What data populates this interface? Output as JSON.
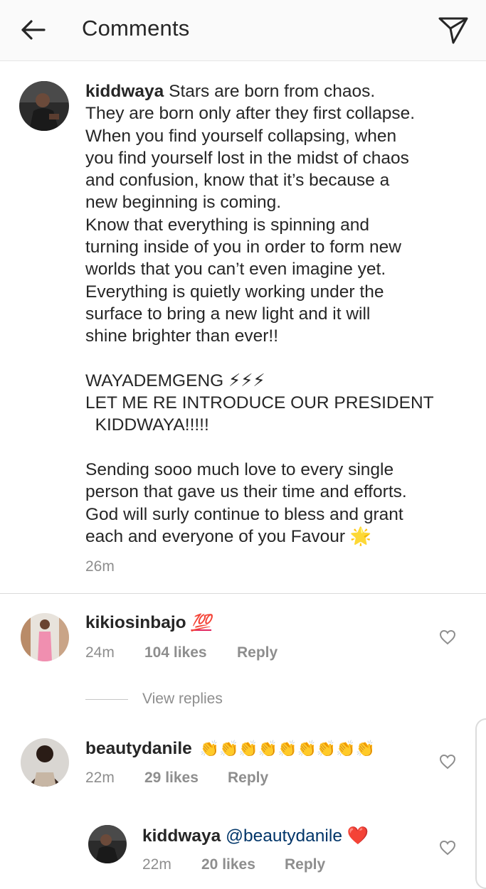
{
  "header": {
    "title": "Comments",
    "back_icon": "arrow-left-icon",
    "send_icon": "paper-plane-icon"
  },
  "caption": {
    "username": "kiddwaya",
    "text": " Stars are born from chaos.\nThey are born only after they first collapse.\nWhen you find yourself collapsing, when\nyou find yourself lost in the midst of chaos\nand confusion, know that it’s because a\nnew beginning is coming.\nKnow that everything is spinning and\nturning inside of you in order to form new\nworlds that you can’t even imagine yet.\nEverything is quietly working under the\nsurface to bring a new light and it will\nshine brighter than ever!!\n\nWAYADEMGENG ⚡⚡⚡\nLET ME RE INTRODUCE OUR PRESIDENT\n  KIDDWAYA!!!!!\n\nSending sooo much love to every single\nperson that gave us their time and efforts.\nGod will surly continue to bless and grant\neach and everyone of you Favour 🌟",
    "time": "26m"
  },
  "comments": [
    {
      "username": "kikiosinbajo",
      "emoji": "💯",
      "time": "24m",
      "likes": "104 likes",
      "reply": "Reply",
      "view_replies": "View replies"
    },
    {
      "username": "beautydanile",
      "emoji": "👏👏👏👏👏👏👏👏👏",
      "time": "22m",
      "likes": "29 likes",
      "reply": "Reply"
    },
    {
      "username": "kiddwaya",
      "mention": "@beautydanile",
      "emoji": "❤️",
      "time": "22m",
      "likes": "20 likes",
      "reply": "Reply"
    }
  ],
  "colors": {
    "text": "#262626",
    "secondary": "#8e8e8e",
    "mention": "#003569",
    "divider": "#dbdbdb"
  }
}
